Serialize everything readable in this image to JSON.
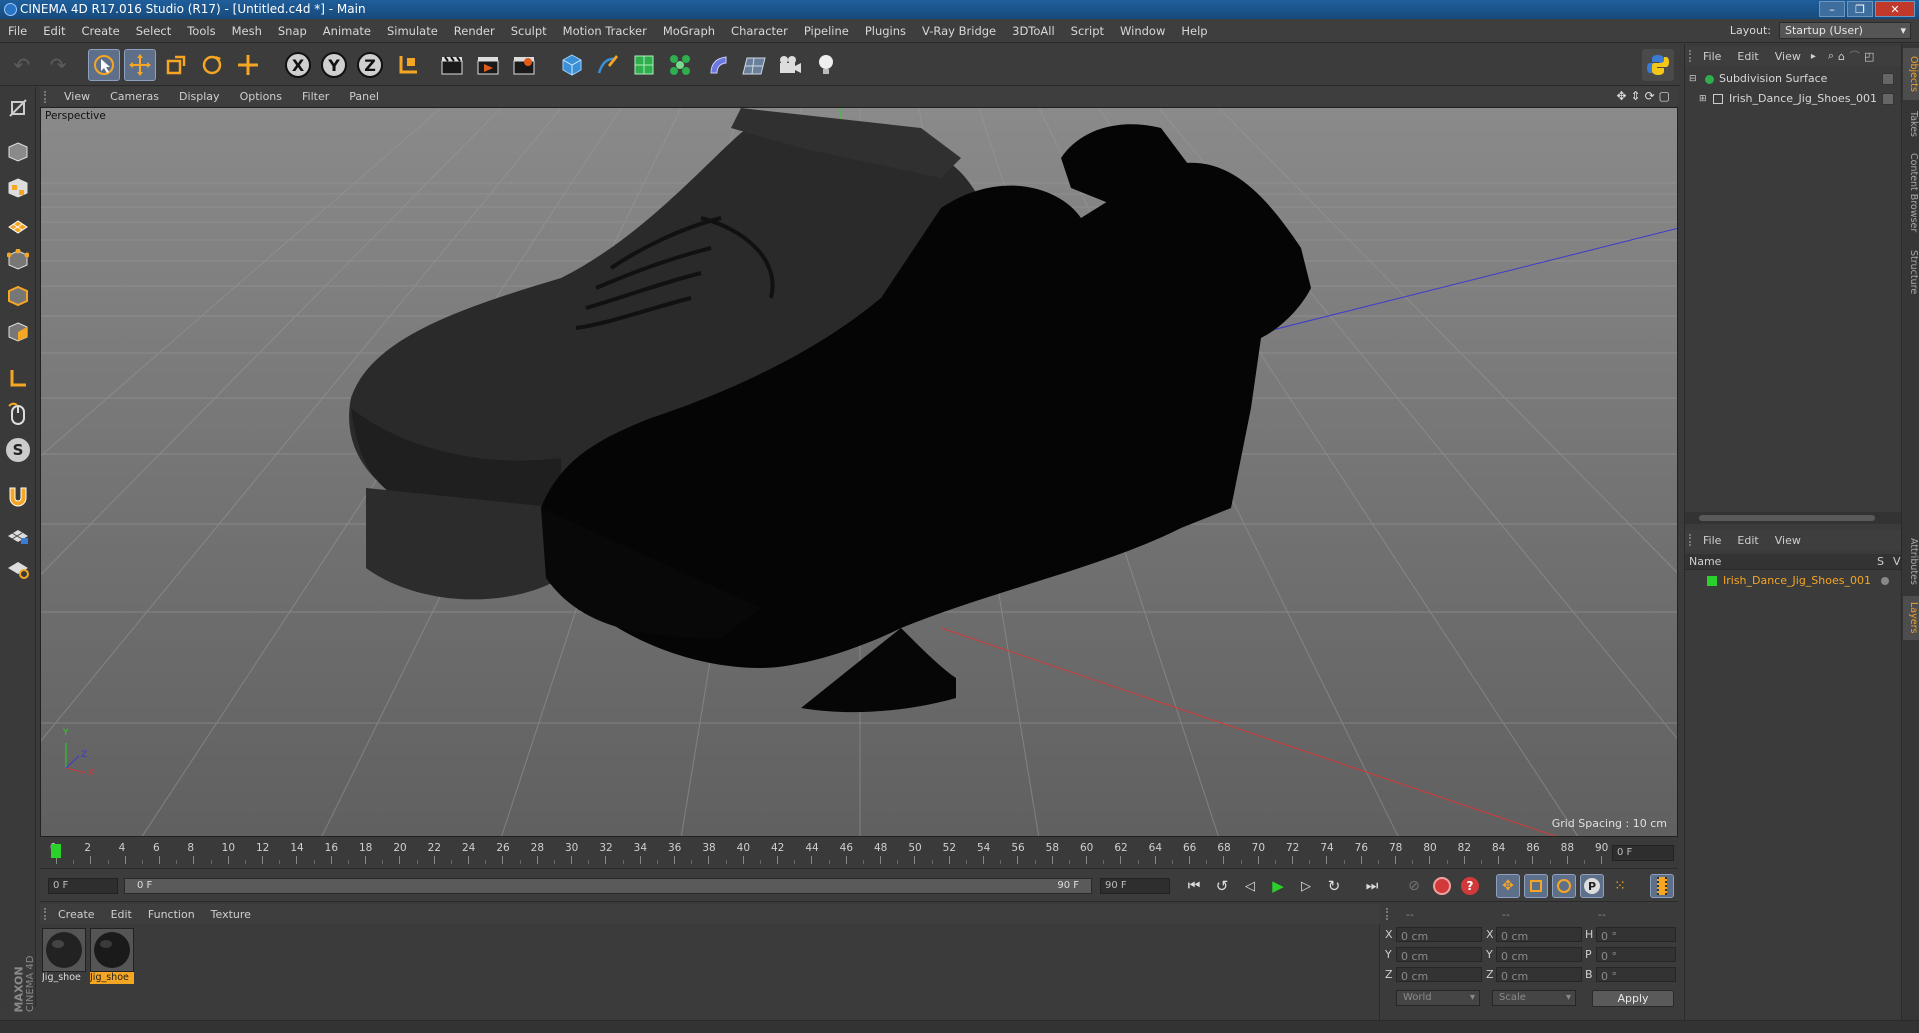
{
  "window": {
    "title": "CINEMA 4D R17.016 Studio (R17) - [Untitled.c4d *] - Main",
    "controls": [
      "–",
      "❐",
      "✕"
    ]
  },
  "menubar": {
    "items": [
      "File",
      "Edit",
      "Create",
      "Select",
      "Tools",
      "Mesh",
      "Snap",
      "Animate",
      "Simulate",
      "Render",
      "Sculpt",
      "Motion Tracker",
      "MoGraph",
      "Character",
      "Pipeline",
      "Plugins",
      "V-Ray Bridge",
      "3DToAll",
      "Script",
      "Window",
      "Help"
    ],
    "layout_label": "Layout:",
    "layout_value": "Startup (User)"
  },
  "toolbar": {
    "axis_x": "X",
    "axis_y": "Y",
    "axis_z": "Z"
  },
  "viewport": {
    "menu": [
      "View",
      "Cameras",
      "Display",
      "Options",
      "Filter",
      "Panel"
    ],
    "camera_label": "Perspective",
    "grid_spacing": "Grid Spacing : 10 cm",
    "axis_labels": {
      "y": "Y",
      "x": "X",
      "z": "Z"
    }
  },
  "timeline": {
    "ticks": [
      "0",
      "2",
      "4",
      "6",
      "8",
      "10",
      "12",
      "14",
      "16",
      "18",
      "20",
      "22",
      "24",
      "26",
      "28",
      "30",
      "32",
      "34",
      "36",
      "38",
      "40",
      "42",
      "44",
      "46",
      "48",
      "50",
      "52",
      "54",
      "56",
      "58",
      "60",
      "62",
      "64",
      "66",
      "68",
      "70",
      "72",
      "74",
      "76",
      "78",
      "80",
      "82",
      "84",
      "86",
      "88",
      "90"
    ],
    "current_frame": "0 F"
  },
  "playback": {
    "start_field": "0 F",
    "slider_start": "0 F",
    "slider_end": "90 F",
    "end_field": "90 F"
  },
  "material_manager": {
    "menu": [
      "Create",
      "Edit",
      "Function",
      "Texture"
    ],
    "materials": [
      {
        "name": "Jig_shoe",
        "selected": false
      },
      {
        "name": "Jig_shoe",
        "selected": true
      }
    ]
  },
  "coordinates": {
    "headers": [
      "--",
      "--",
      "--"
    ],
    "rows": [
      {
        "a": "X",
        "av": "0 cm",
        "b": "X",
        "bv": "0 cm",
        "c": "H",
        "cv": "0 °"
      },
      {
        "a": "Y",
        "av": "0 cm",
        "b": "Y",
        "bv": "0 cm",
        "c": "P",
        "cv": "0 °"
      },
      {
        "a": "Z",
        "av": "0 cm",
        "b": "Z",
        "bv": "0 cm",
        "c": "B",
        "cv": "0 °"
      }
    ],
    "world": "World",
    "scale": "Scale",
    "apply": "Apply"
  },
  "objects_panel": {
    "menu": [
      "File",
      "Edit",
      "View"
    ],
    "items": [
      "Subdivision Surface",
      "Irish_Dance_Jig_Shoes_001"
    ]
  },
  "layers_panel": {
    "menu": [
      "File",
      "Edit",
      "View"
    ],
    "col_name": "Name",
    "col_s": "S",
    "col_v": "V",
    "items": [
      "Irish_Dance_Jig_Shoes_001"
    ]
  },
  "side_tabs": [
    "Objects",
    "Takes",
    "Content Browser",
    "Structure",
    "Attributes",
    "Layers"
  ],
  "maxon": {
    "brand": "MAXON",
    "product": "CINEMA 4D"
  },
  "colors": {
    "accent": "#f5a623",
    "select_blue": "#5e6f89",
    "axis_green": "#2bd12b",
    "axis_red": "#d23a3a",
    "axis_blue": "#3a3ad2"
  }
}
